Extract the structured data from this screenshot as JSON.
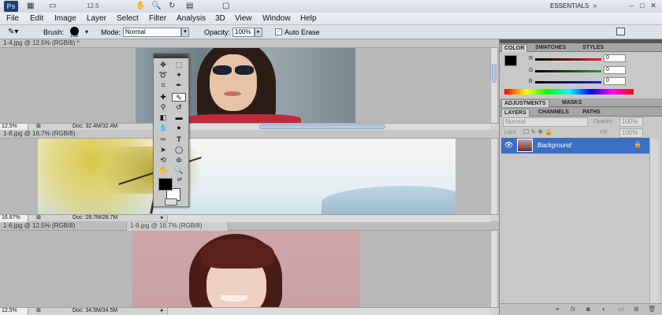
{
  "app": {
    "logo": "Ps",
    "zoom": "12.5",
    "workspace": "ESSENTIALS"
  },
  "menu": [
    "File",
    "Edit",
    "Image",
    "Layer",
    "Select",
    "Filter",
    "Analysis",
    "3D",
    "View",
    "Window",
    "Help"
  ],
  "options": {
    "brush_label": "Brush:",
    "brush_size": "168",
    "mode_label": "Mode:",
    "mode_value": "Normal",
    "opacity_label": "Opacity:",
    "opacity_value": "100%",
    "auto_erase_label": "Auto Erase",
    "auto_erase_checked": true
  },
  "documents": [
    {
      "title": "1-4.jpg @ 12.5% (RGB/8) *",
      "zoom": "12.5%",
      "doc_size": "Doc: 32.4M/32.4M"
    },
    {
      "title": "1-8.jpg @ 16.7% (RGB/8)",
      "zoom": "16.67%",
      "doc_size": "Doc: 28.7M/28.7M"
    },
    {
      "title": "1-6.jpg @ 12.5% (RGB/8)",
      "title2": "1-9.jpg @ 16.7% (RGB/8)",
      "zoom": "12.5%",
      "doc_size": "Doc: 34.5M/34.5M"
    }
  ],
  "color_panel": {
    "tabs": [
      "COLOR",
      "SWATCHES",
      "STYLES"
    ],
    "channels": [
      {
        "label": "R",
        "value": "0",
        "color": "#e02020"
      },
      {
        "label": "G",
        "value": "0",
        "color": "#20a020"
      },
      {
        "label": "B",
        "value": "0",
        "color": "#2020d0"
      }
    ]
  },
  "adjust_panel": {
    "tabs": [
      "ADJUSTMENTS",
      "MASKS"
    ]
  },
  "layers_panel": {
    "tabs": [
      "LAYERS",
      "CHANNELS",
      "PATHS"
    ],
    "blend_mode": "Normal",
    "opacity_label": "Opacity:",
    "opacity_value": "100%",
    "lock_label": "Lock:",
    "fill_label": "Fill:",
    "fill_value": "100%",
    "layer_name": "Background"
  },
  "colors": {
    "accent": "#3a6fc4",
    "foreground": "#000000",
    "background": "#ffffff"
  }
}
